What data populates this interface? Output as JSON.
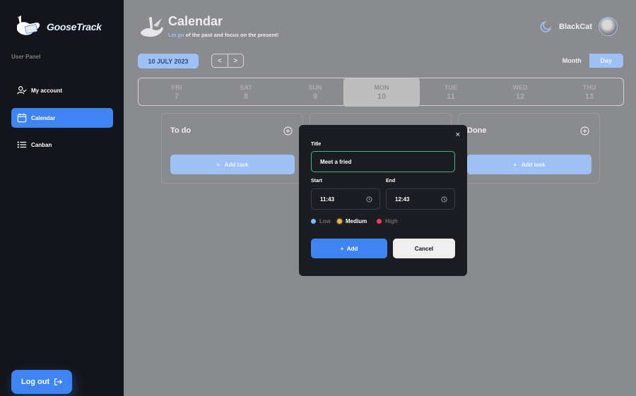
{
  "app": {
    "name": "GooseTrack"
  },
  "sidebar": {
    "panel_label": "User Panel",
    "items": [
      {
        "label": "My account",
        "icon": "user-check-icon"
      },
      {
        "label": "Calendar",
        "icon": "calendar-icon"
      },
      {
        "label": "Canban",
        "icon": "list-icon"
      }
    ],
    "logout_label": "Log out"
  },
  "header": {
    "title": "Calendar",
    "subtitle_accent": "Let go",
    "subtitle_rest": " of the past and focus on the present!",
    "username": "BlackCat"
  },
  "toolbar": {
    "date": "10 JULY 2023",
    "prev": "<",
    "next": ">",
    "view_month": "Month",
    "view_day": "Day"
  },
  "week": [
    {
      "day": "FRI",
      "num": "7"
    },
    {
      "day": "SAT",
      "num": "8"
    },
    {
      "day": "SUN",
      "num": "9"
    },
    {
      "day": "MON",
      "num": "10"
    },
    {
      "day": "TUE",
      "num": "11"
    },
    {
      "day": "WED",
      "num": "12"
    },
    {
      "day": "THU",
      "num": "13"
    }
  ],
  "columns": [
    {
      "title": "To do",
      "add_label": "Add task"
    },
    {
      "title": "Done",
      "add_label": "Add task"
    }
  ],
  "modal": {
    "close": "×",
    "title_label": "Title",
    "title_value": "Meet a fried",
    "start_label": "Start",
    "start_value": "11:43",
    "end_label": "End",
    "end_value": "12:43",
    "priorities": [
      {
        "label": "Low",
        "color": "#72c2f8"
      },
      {
        "label": "Medium",
        "color": "#f3b249"
      },
      {
        "label": "High",
        "color": "#ea3d65"
      }
    ],
    "selected_priority": "Medium",
    "add_label": "Add",
    "cancel_label": "Cancel"
  },
  "colors": {
    "accent": "#3e85f3",
    "sidebar_bg": "#13151a",
    "title_border": "#3cbc81"
  }
}
